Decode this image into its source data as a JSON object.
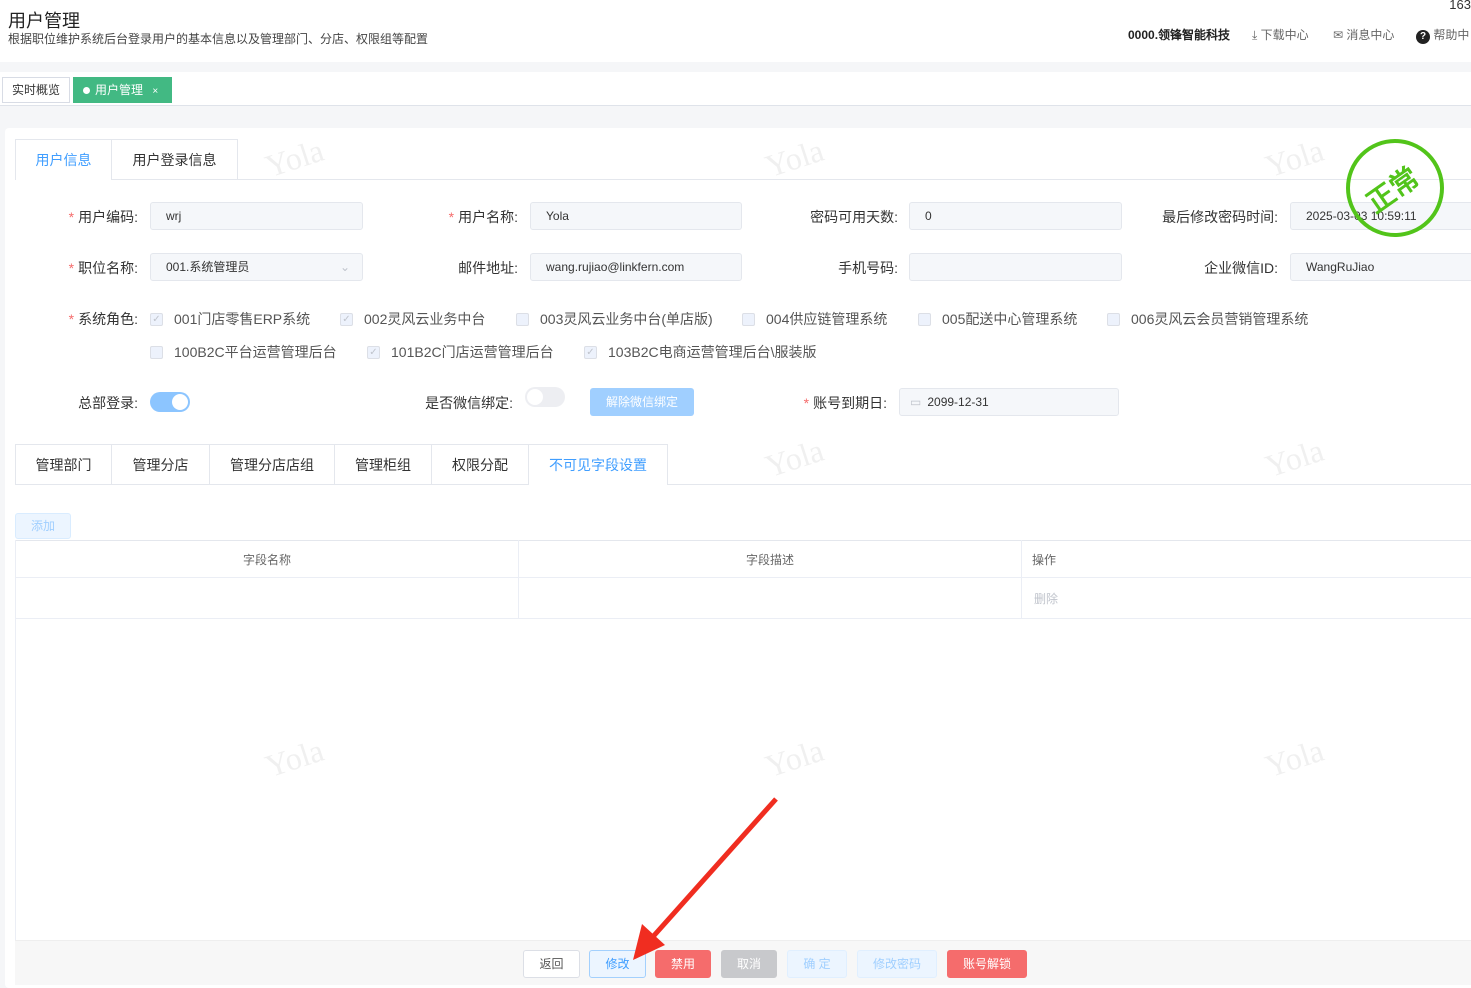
{
  "header": {
    "title": "用户管理",
    "subtitle": "根据职位维护系统后台登录用户的基本信息以及管理部门、分店、权限组等配置",
    "corner_number": "163",
    "company": "0000.领锋智能科技",
    "download": "下载中心",
    "messages": "消息中心",
    "help": "帮助中"
  },
  "page_tabs": [
    {
      "label": "实时概览"
    },
    {
      "label": "用户管理",
      "close": "×"
    }
  ],
  "info_tabs": [
    {
      "label": "用户信息"
    },
    {
      "label": "用户登录信息"
    }
  ],
  "watermark": "Yola",
  "status_stamp": "正常",
  "colors": {
    "primary": "#409eff",
    "green": "#42b983",
    "danger": "#f56c6c",
    "stamp": "#52c41a"
  },
  "form": {
    "user_code": {
      "label": "用户编码:",
      "value": "wrj"
    },
    "user_name": {
      "label": "用户名称:",
      "value": "Yola"
    },
    "pwd_days": {
      "label": "密码可用天数:",
      "value": "0"
    },
    "pwd_time": {
      "label": "最后修改密码时间:",
      "value": "2025-03-03 10:59:11"
    },
    "position": {
      "label": "职位名称:",
      "value": "001.系统管理员"
    },
    "email": {
      "label": "邮件地址:",
      "value": "wang.rujiao@linkfern.com"
    },
    "phone": {
      "label": "手机号码:",
      "value": ""
    },
    "wechat_id": {
      "label": "企业微信ID:",
      "value": "WangRuJiao"
    },
    "roles_label": "系统角色:",
    "roles": [
      {
        "label": "001门店零售ERP系统",
        "checked": true
      },
      {
        "label": "002灵风云业务中台",
        "checked": true
      },
      {
        "label": "003灵风云业务中台(单店版)",
        "checked": false
      },
      {
        "label": "004供应链管理系统",
        "checked": false
      },
      {
        "label": "005配送中心管理系统",
        "checked": false
      },
      {
        "label": "006灵风云会员营销管理系统",
        "checked": false
      },
      {
        "label": "100B2C平台运营管理后台",
        "checked": false
      },
      {
        "label": "101B2C门店运营管理后台",
        "checked": true
      },
      {
        "label": "103B2C电商运营管理后台\\服装版",
        "checked": true
      }
    ],
    "hq_login": {
      "label": "总部登录:",
      "on": true
    },
    "wechat_bind": {
      "label": "是否微信绑定:",
      "on": false
    },
    "unbind_button": "解除微信绑定",
    "expire": {
      "label": "账号到期日:",
      "value": "2099-12-31"
    }
  },
  "sub_tabs": [
    {
      "label": "管理部门"
    },
    {
      "label": "管理分店"
    },
    {
      "label": "管理分店店组"
    },
    {
      "label": "管理柜组"
    },
    {
      "label": "权限分配"
    },
    {
      "label": "不可见字段设置"
    }
  ],
  "add_button": "添加",
  "table": {
    "columns": [
      "字段名称",
      "字段描述",
      "操作"
    ],
    "rows": [
      {
        "name": "",
        "desc": "",
        "action": "删除"
      }
    ]
  },
  "footer": {
    "back": "返回",
    "edit": "修改",
    "disable": "禁用",
    "cancel": "取消",
    "confirm": "确 定",
    "change_pwd": "修改密码",
    "unlock": "账号解锁"
  }
}
